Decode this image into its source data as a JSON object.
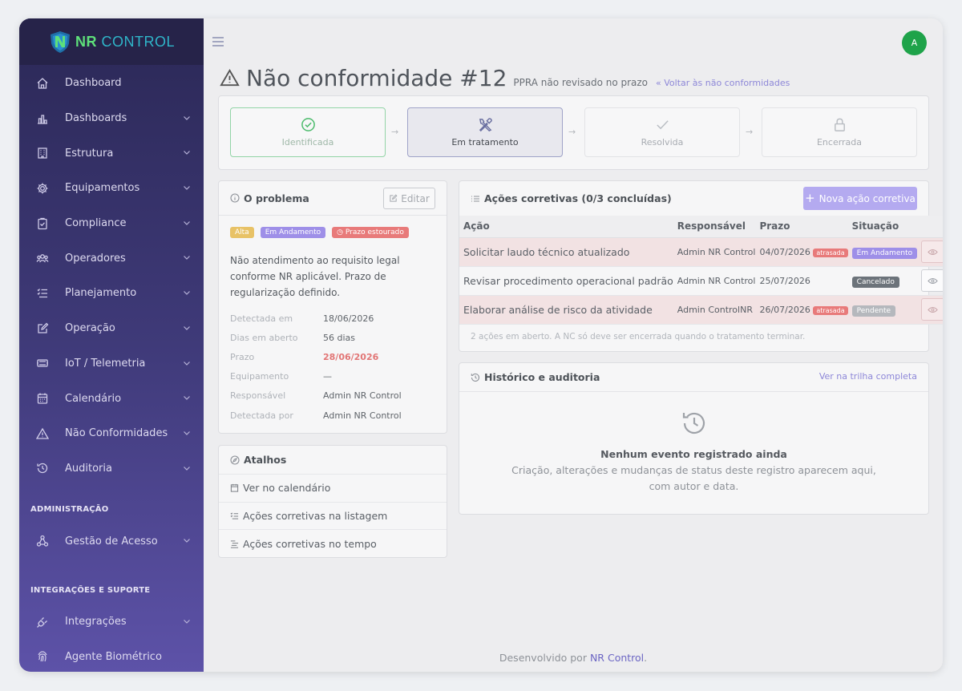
{
  "brand": {
    "name_a": "NR",
    "name_b": "CONTROL"
  },
  "user": {
    "avatar_initial": "A"
  },
  "sidebar": {
    "items": [
      {
        "label": "Dashboard"
      },
      {
        "label": "Dashboards"
      },
      {
        "label": "Estrutura"
      },
      {
        "label": "Equipamentos"
      },
      {
        "label": "Compliance"
      },
      {
        "label": "Operadores"
      },
      {
        "label": "Planejamento"
      },
      {
        "label": "Operação"
      },
      {
        "label": "IoT / Telemetria"
      },
      {
        "label": "Calendário"
      },
      {
        "label": "Não Conformidades"
      },
      {
        "label": "Auditoria"
      }
    ],
    "section_admin": "ADMINISTRAÇÃO",
    "admin_items": [
      {
        "label": "Gestão de Acesso"
      }
    ],
    "section_integ": "INTEGRAÇÕES E SUPORTE",
    "integ_items": [
      {
        "label": "Integrações"
      },
      {
        "label": "Agente Biométrico"
      }
    ]
  },
  "header": {
    "title": "Não conformidade #12",
    "subtitle": "PPRA não revisado no prazo",
    "back_link": "« Voltar às não conformidades"
  },
  "stepper": {
    "steps": [
      {
        "label": "Identificada",
        "state": "done"
      },
      {
        "label": "Em tratamento",
        "state": "active"
      },
      {
        "label": "Resolvida",
        "state": "pending"
      },
      {
        "label": "Encerrada",
        "state": "pending"
      }
    ],
    "arrow": "→"
  },
  "problem": {
    "title": "O problema",
    "edit_label": "Editar",
    "badges": {
      "severity": "Alta",
      "status": "Em Andamento",
      "deadline": "Prazo estourado"
    },
    "description": "Não atendimento ao requisito legal conforme NR aplicável. Prazo de regularização definido.",
    "fields": [
      {
        "key": "Detectada em",
        "value": "18/06/2026"
      },
      {
        "key": "Dias em aberto",
        "value": "56 dias"
      },
      {
        "key": "Prazo",
        "value": "28/06/2026"
      },
      {
        "key": "Equipamento",
        "value": "—"
      },
      {
        "key": "Responsável",
        "value": "Admin NR Control"
      },
      {
        "key": "Detectada por",
        "value": "Admin NR Control"
      }
    ]
  },
  "shortcuts": {
    "title": "Atalhos",
    "items": [
      {
        "label": "Ver no calendário"
      },
      {
        "label": "Ações corretivas na listagem"
      },
      {
        "label": "Ações corretivas no tempo"
      }
    ]
  },
  "actions": {
    "title": "Ações corretivas (0/3 concluídas)",
    "new_label": "Nova ação corretiva",
    "columns": [
      "Ação",
      "Responsável",
      "Prazo",
      "Situação"
    ],
    "late_label": "atrasada",
    "rows": [
      {
        "action": "Solicitar laudo técnico atualizado",
        "owner": "Admin NR Control",
        "deadline": "04/07/2026",
        "late": true,
        "status": "Em Andamento"
      },
      {
        "action": "Revisar procedimento operacional padrão",
        "owner": "Admin NR Control",
        "deadline": "25/07/2026",
        "late": false,
        "status": "Cancelado"
      },
      {
        "action": "Elaborar análise de risco da atividade",
        "owner": "Admin ControlNR",
        "deadline": "26/07/2026",
        "late": true,
        "status": "Pendente"
      }
    ],
    "note": "2 ações em aberto. A NC só deve ser encerrada quando o tratamento terminar."
  },
  "history": {
    "title": "Histórico e auditoria",
    "link": "Ver na trilha completa",
    "empty_title": "Nenhum evento registrado ainda",
    "empty_desc_1": "Criação, alterações e mudanças de status deste registro aparecem aqui,",
    "empty_desc_2": "com autor e data."
  },
  "footer": {
    "prefix": "Desenvolvido por",
    "brand": "NR Control",
    "suffix": "."
  },
  "colors": {
    "accent": "#b4aaf0",
    "success": "#1fa34a",
    "danger": "#e87a7a",
    "warning": "#e8c266"
  }
}
